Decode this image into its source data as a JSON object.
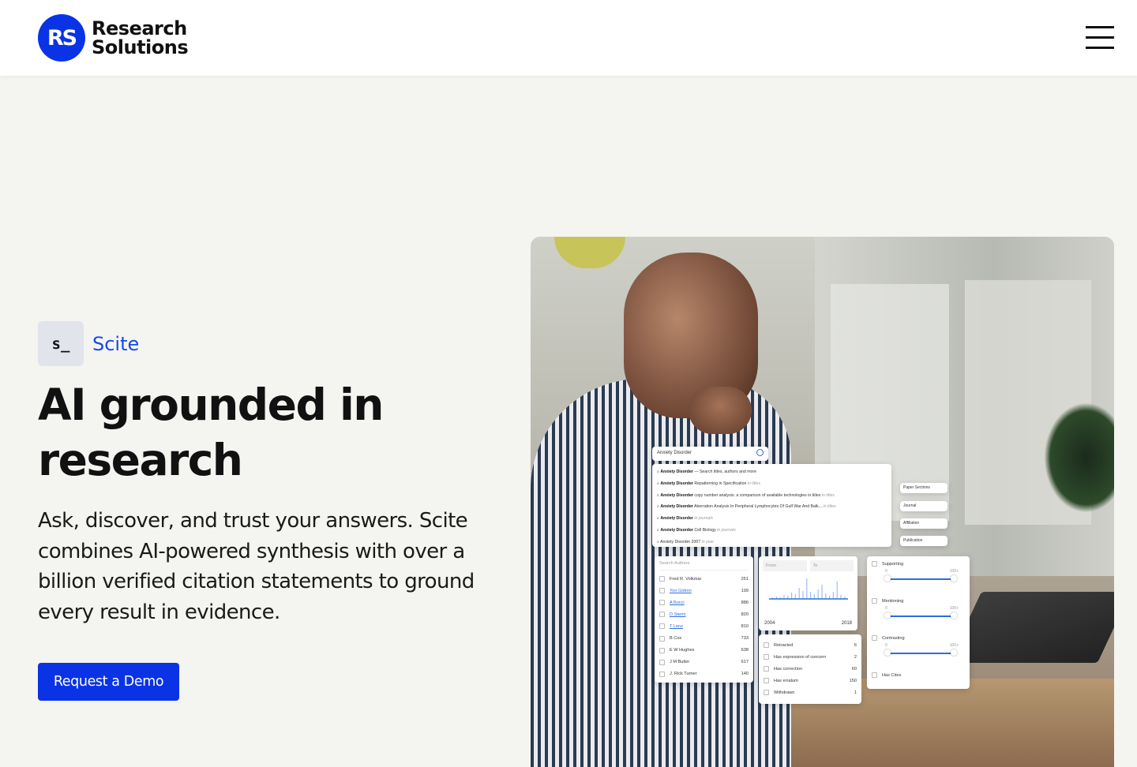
{
  "brand": {
    "mark": "RS",
    "name_line1": "Research",
    "name_line2": "Solutions"
  },
  "header": {
    "menu_icon": "hamburger-menu-icon"
  },
  "product": {
    "icon_text": "s_",
    "name": "Scite"
  },
  "hero": {
    "title": "AI grounded in research",
    "description": "Ask, discover, and trust your answers. Scite combines AI-powered synthesis with over a billion verified citation statements to ground every result in evidence.",
    "cta_label": "Request a Demo"
  },
  "colors": {
    "brand_blue": "#0a33e6",
    "link_blue": "#1749e8",
    "background": "#f4f4f0"
  },
  "overlay": {
    "search_value": "Anxiety Disorder",
    "suggestions": [
      {
        "bold": "Anxiety Disorder",
        "text": " — Search titles, authors and more",
        "scope": ""
      },
      {
        "bold": "Anxiety Disorder",
        "text": " Repatterning in Specification ",
        "scope": "in titles"
      },
      {
        "bold": "Anxiety Disorder",
        "text": " copy number analysis: a comparison of available technologies in titles ",
        "scope": "in titles"
      },
      {
        "bold": "Anxiety Disorder",
        "text": " Aberration Analysis In Peripheral Lymphocytes Of Gulf War And Balk... ",
        "scope": "in titles"
      },
      {
        "bold": "Anxiety Disorder",
        "text": " ",
        "scope": "in journals"
      },
      {
        "bold": "Anxiety Disorder",
        "text": " Cell Biology ",
        "scope": "in journals"
      },
      {
        "bold": "",
        "text": "Anxiety Disorder 2007 ",
        "scope": "in year"
      }
    ],
    "filters": [
      "Paper Sections",
      "Journal",
      "Affiliation",
      "Publication"
    ],
    "authors_placeholder": "Search Authors",
    "authors": [
      {
        "name": "Fred R. Volkmar",
        "count": "251",
        "link": false
      },
      {
        "name": "Yori Gidron",
        "count": "199",
        "link": true
      },
      {
        "name": "A Bocci",
        "count": "886",
        "link": true
      },
      {
        "name": "D Sterm",
        "count": "820",
        "link": true
      },
      {
        "name": "T Lenz",
        "count": "810",
        "link": true
      },
      {
        "name": "B Cox",
        "count": "733",
        "link": false
      },
      {
        "name": "E W Hughes",
        "count": "638",
        "link": false
      },
      {
        "name": "J M Butler",
        "count": "617",
        "link": false
      },
      {
        "name": "J. Rick Turner",
        "count": "140",
        "link": false
      }
    ],
    "years": {
      "from": "From",
      "to": "To",
      "start": "2004",
      "end": "2018"
    },
    "status": [
      {
        "name": "Retracted",
        "count": "6"
      },
      {
        "name": "Has expression of concern",
        "count": "2"
      },
      {
        "name": "Has correction",
        "count": "60"
      },
      {
        "name": "Has erratum",
        "count": "150"
      },
      {
        "name": "Withdrawn",
        "count": "1"
      }
    ],
    "citations": [
      {
        "name": "Supporting",
        "min": "0",
        "max": "100+"
      },
      {
        "name": "Mentioning",
        "min": "0",
        "max": "100+"
      },
      {
        "name": "Contrasting",
        "min": "0",
        "max": "100+"
      }
    ],
    "has_cites": "Has Cites"
  }
}
